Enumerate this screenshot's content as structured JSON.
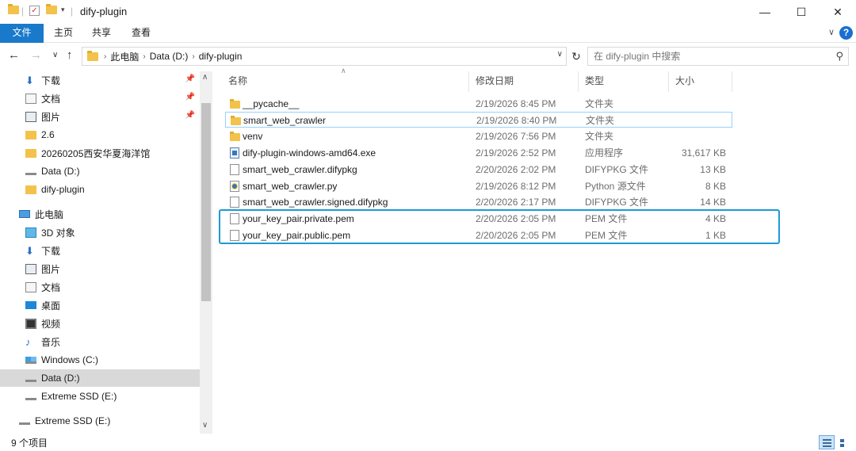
{
  "window": {
    "title": "dify-plugin",
    "minimize": "—",
    "maximize": "☐",
    "close": "✕"
  },
  "ribbon": {
    "tabs": [
      "文件",
      "主页",
      "共享",
      "查看"
    ],
    "help": "?"
  },
  "address": {
    "crumbs": [
      "此电脑",
      "Data (D:)",
      "dify-plugin"
    ],
    "search_placeholder": "在 dify-plugin 中搜索"
  },
  "sidebar": {
    "items": [
      {
        "label": "下载",
        "icon": "download-icon",
        "pinned": true
      },
      {
        "label": "文档",
        "icon": "document-icon",
        "pinned": true
      },
      {
        "label": "图片",
        "icon": "picture-icon",
        "pinned": true
      },
      {
        "label": "2.6",
        "icon": "folder-icon",
        "pinned": false
      },
      {
        "label": "20260205西安华夏海洋馆",
        "icon": "folder-icon",
        "pinned": false
      },
      {
        "label": "Data (D:)",
        "icon": "drive-icon",
        "pinned": false
      },
      {
        "label": "dify-plugin",
        "icon": "folder-icon",
        "pinned": false
      },
      {
        "label": "此电脑",
        "icon": "computer-icon",
        "pinned": false
      },
      {
        "label": "3D 对象",
        "icon": "3d-objects-icon",
        "pinned": false
      },
      {
        "label": "下载",
        "icon": "download-icon",
        "pinned": false
      },
      {
        "label": "图片",
        "icon": "picture-icon",
        "pinned": false
      },
      {
        "label": "文档",
        "icon": "document-icon",
        "pinned": false
      },
      {
        "label": "桌面",
        "icon": "desktop-icon",
        "pinned": false
      },
      {
        "label": "视频",
        "icon": "video-icon",
        "pinned": false
      },
      {
        "label": "音乐",
        "icon": "music-icon",
        "pinned": false
      },
      {
        "label": "Windows (C:)",
        "icon": "windows-drive-icon",
        "pinned": false
      },
      {
        "label": "Data (D:)",
        "icon": "drive-icon",
        "pinned": false,
        "selected": true
      },
      {
        "label": "Extreme SSD (E:)",
        "icon": "drive-icon",
        "pinned": false
      },
      {
        "label": "Extreme SSD (E:)",
        "icon": "drive-icon",
        "pinned": false
      }
    ]
  },
  "columns": [
    "名称",
    "修改日期",
    "类型",
    "大小"
  ],
  "files": [
    {
      "name": "__pycache__",
      "date": "2/19/2026 8:45 PM",
      "type": "文件夹",
      "size": "",
      "icon": "folder-icon"
    },
    {
      "name": "smart_web_crawler",
      "date": "2/19/2026 8:40 PM",
      "type": "文件夹",
      "size": "",
      "icon": "folder-icon"
    },
    {
      "name": "venv",
      "date": "2/19/2026 7:56 PM",
      "type": "文件夹",
      "size": "",
      "icon": "folder-icon"
    },
    {
      "name": "dify-plugin-windows-amd64.exe",
      "date": "2/19/2026 2:52 PM",
      "type": "应用程序",
      "size": "31,617 KB",
      "icon": "exe-icon"
    },
    {
      "name": "smart_web_crawler.difypkg",
      "date": "2/20/2026 2:02 PM",
      "type": "DIFYPKG 文件",
      "size": "13 KB",
      "icon": "file-icon"
    },
    {
      "name": "smart_web_crawler.py",
      "date": "2/19/2026 8:12 PM",
      "type": "Python 源文件",
      "size": "8 KB",
      "icon": "python-file-icon"
    },
    {
      "name": "smart_web_crawler.signed.difypkg",
      "date": "2/20/2026 2:17 PM",
      "type": "DIFYPKG 文件",
      "size": "14 KB",
      "icon": "file-icon"
    },
    {
      "name": "your_key_pair.private.pem",
      "date": "2/20/2026 2:05 PM",
      "type": "PEM 文件",
      "size": "4 KB",
      "icon": "file-icon"
    },
    {
      "name": "your_key_pair.public.pem",
      "date": "2/20/2026 2:05 PM",
      "type": "PEM 文件",
      "size": "1 KB",
      "icon": "file-icon"
    }
  ],
  "status": {
    "item_count": "9 个项目"
  },
  "colors": {
    "accent": "#1979ca",
    "selection": "#d9d9d9",
    "highlight_box": "#1c9ad6"
  }
}
